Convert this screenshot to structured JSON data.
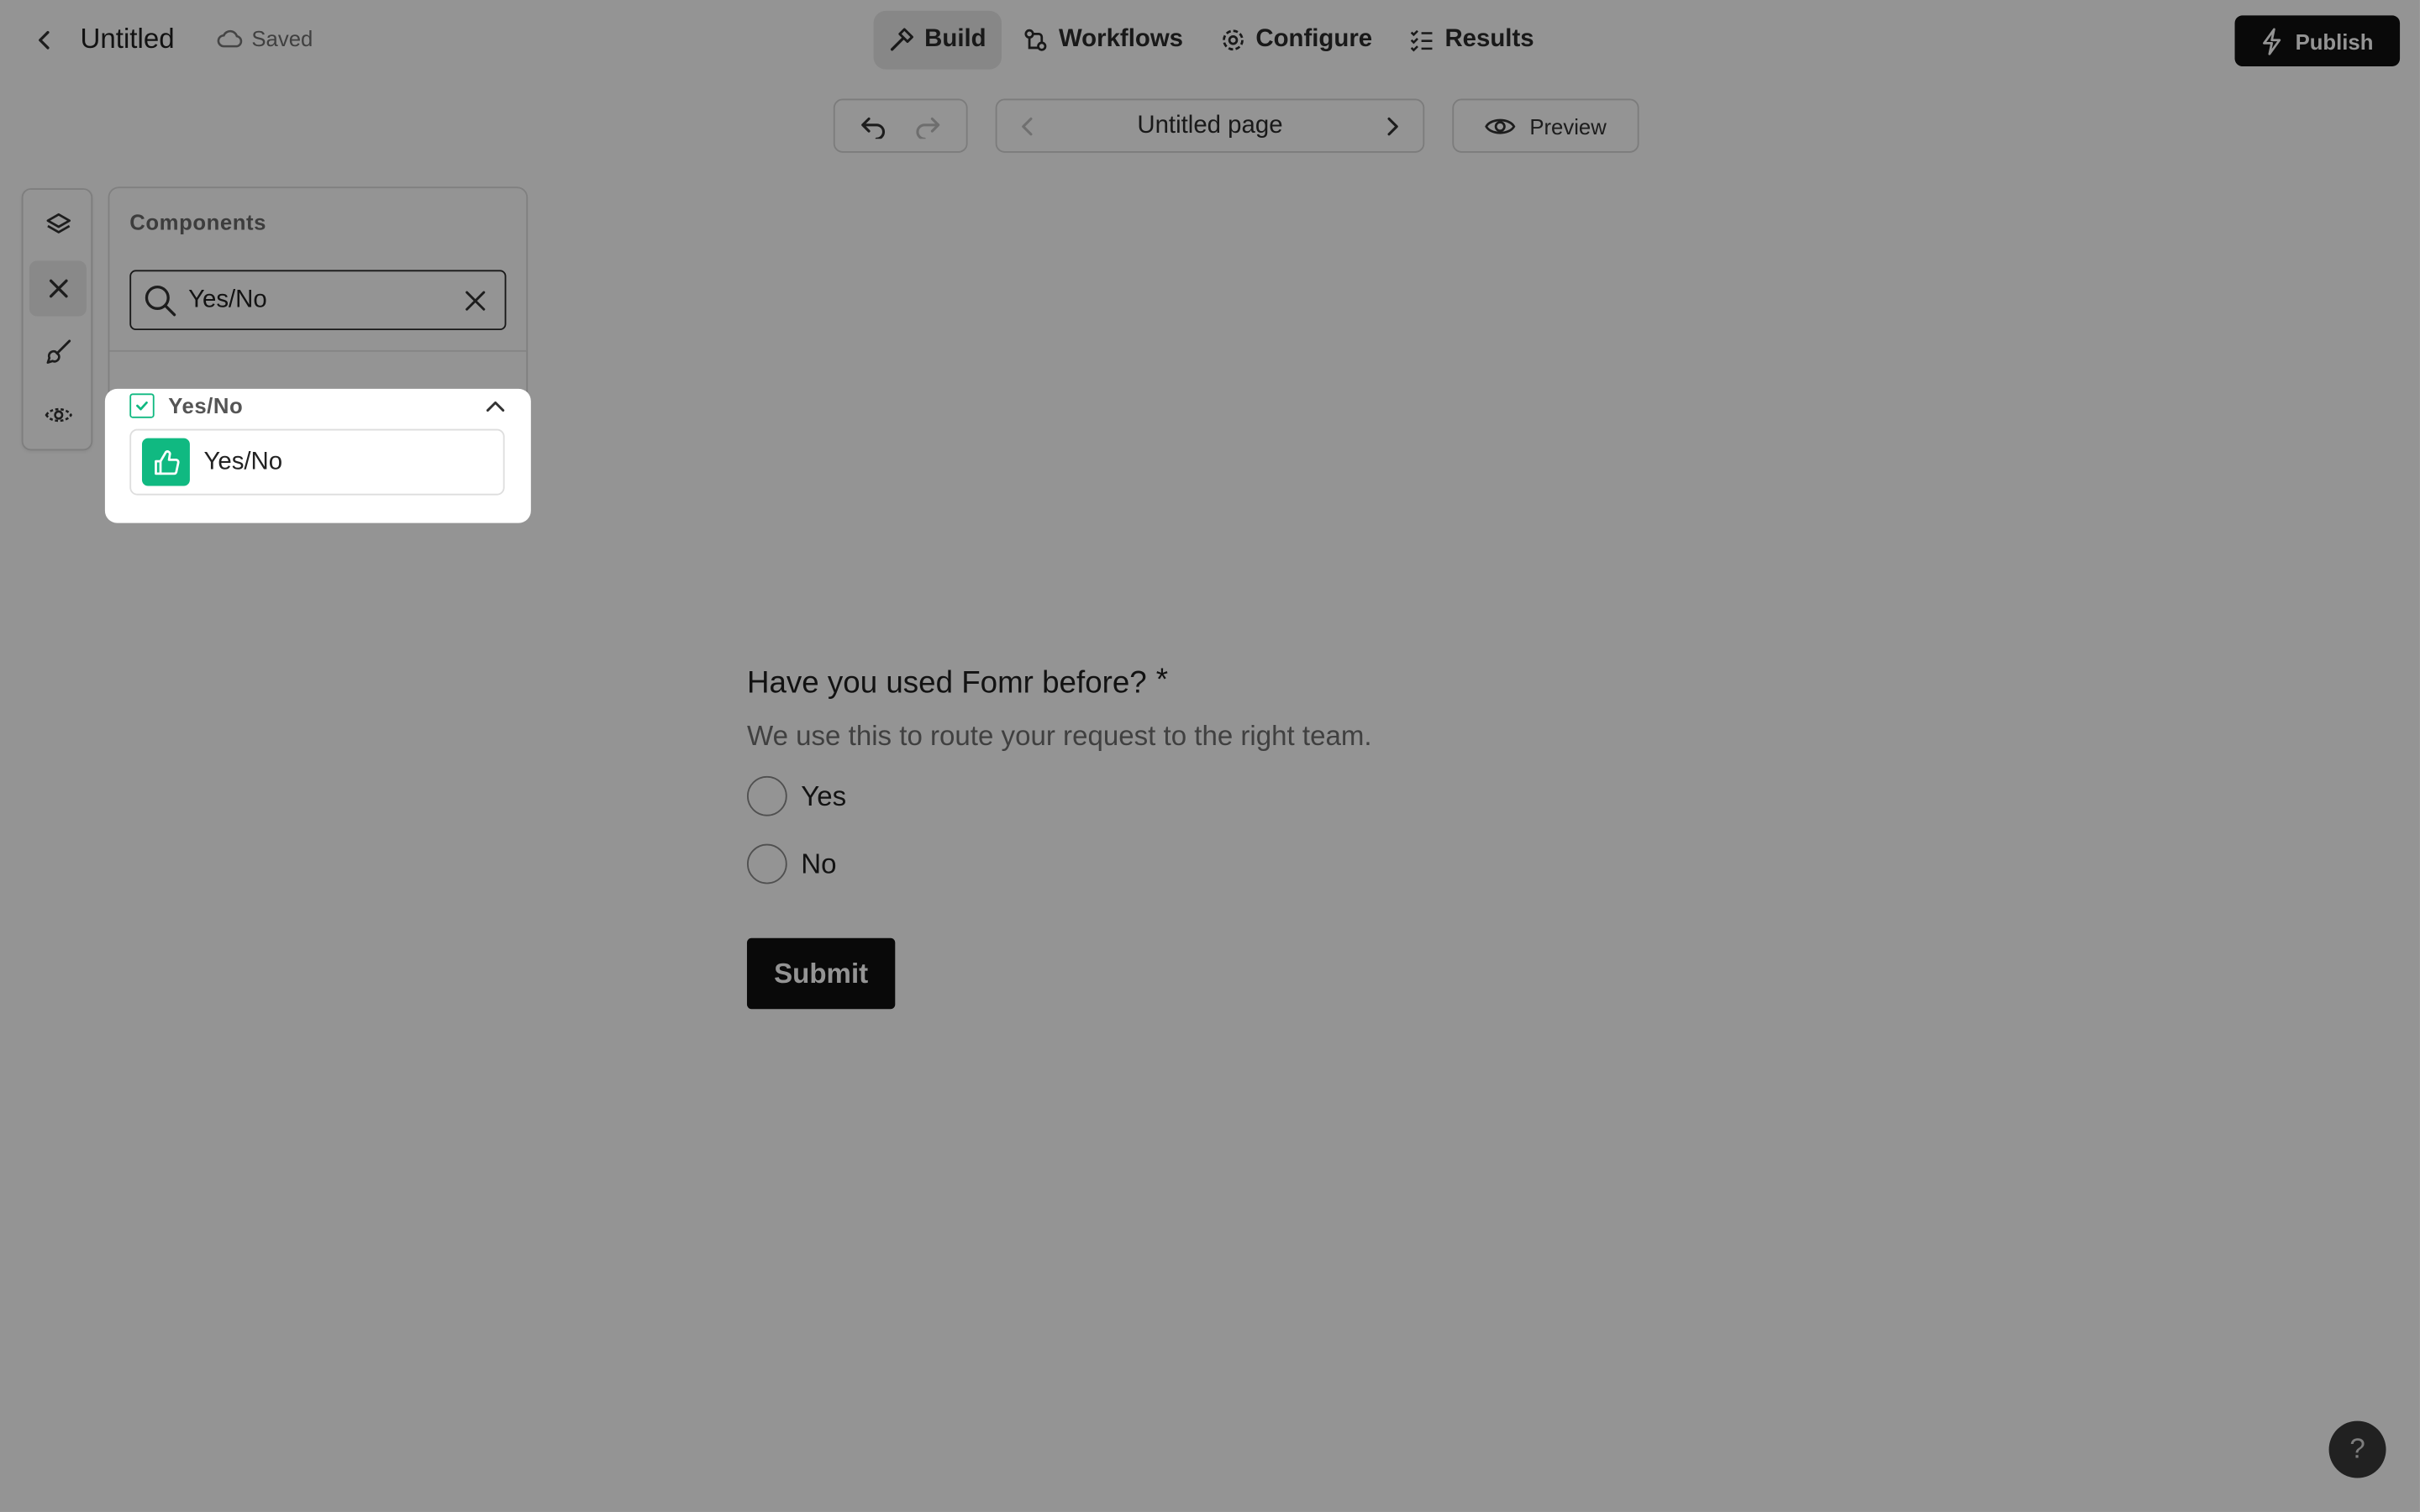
{
  "header": {
    "back_icon": "chevron-left-icon",
    "title": "Untitled",
    "saved_status": "Saved",
    "tabs": [
      {
        "label": "Build",
        "icon": "hammer-icon",
        "active": true
      },
      {
        "label": "Workflows",
        "icon": "workflow-icon",
        "active": false
      },
      {
        "label": "Configure",
        "icon": "gear-icon",
        "active": false
      },
      {
        "label": "Results",
        "icon": "checklist-icon",
        "active": false
      }
    ],
    "publish_label": "Publish"
  },
  "page_toolbar": {
    "page_name": "Untitled page",
    "preview_label": "Preview"
  },
  "components_panel": {
    "title": "Components",
    "search_value": "Yes/No",
    "group_label": "Yes/No",
    "item_label": "Yes/No",
    "item_color": "#10b981"
  },
  "form": {
    "question": "Have you used Fomr before?",
    "required_mark": "*",
    "description": "We use this to route your request to the right team.",
    "options": [
      "Yes",
      "No"
    ],
    "submit_label": "Submit"
  },
  "help_label": "?",
  "colors": {
    "accent_green": "#10b981",
    "dark_button": "#111111",
    "overlay": "rgba(0,0,0,0.42)"
  }
}
